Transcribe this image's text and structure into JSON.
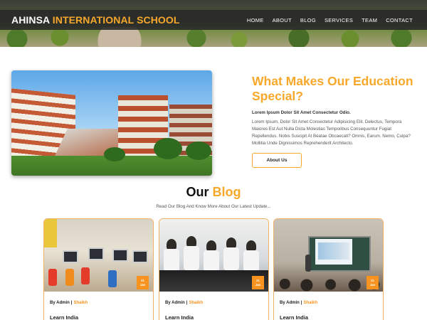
{
  "header": {
    "brand_white": "AHINSA",
    "brand_orange": "INTERNATIONAL SCHOOL",
    "nav": [
      "HOME",
      "ABOUT",
      "BLOG",
      "SERVICES",
      "TEAM",
      "CONTACT"
    ]
  },
  "feature": {
    "title": "What Makes Our Education Special?",
    "subtitle": "Lorem Ipsum Dolor Sit Amet Consectetur Odio.",
    "body": "Lorem Ipsum, Dolor Sit Amet Consectetur Adipisicing Elit. Delectus, Tempora Maiores Est Aut Nulla Dicta Molestias Temporibus Consequuntur Fugiat Repellendus. Nobis Suscipit At Beatae Obcaecati? Omnis, Earum. Nemo, Culpa? Mollitia Unde Dignissimos Reprehenderit Architecto.",
    "button_label": "About Us"
  },
  "blog": {
    "title_dark": "Our",
    "title_orange": "Blog",
    "subtitle": "Read Our Blog And Know More About Our Latest Update...",
    "cards": [
      {
        "day": "21",
        "month": "Jan",
        "by": "By Admin",
        "sep": "|",
        "tag": "Shaikh",
        "title": "Learn India"
      },
      {
        "day": "21",
        "month": "Jan",
        "by": "By Admin",
        "sep": "|",
        "tag": "Shaikh",
        "title": "Learn India"
      },
      {
        "day": "21",
        "month": "Jan",
        "by": "By Admin",
        "sep": "|",
        "tag": "Shaikh",
        "title": "Learn India"
      }
    ]
  },
  "colors": {
    "accent": "#f7a82a",
    "badge": "#f7931e",
    "navbar": "#282828"
  }
}
